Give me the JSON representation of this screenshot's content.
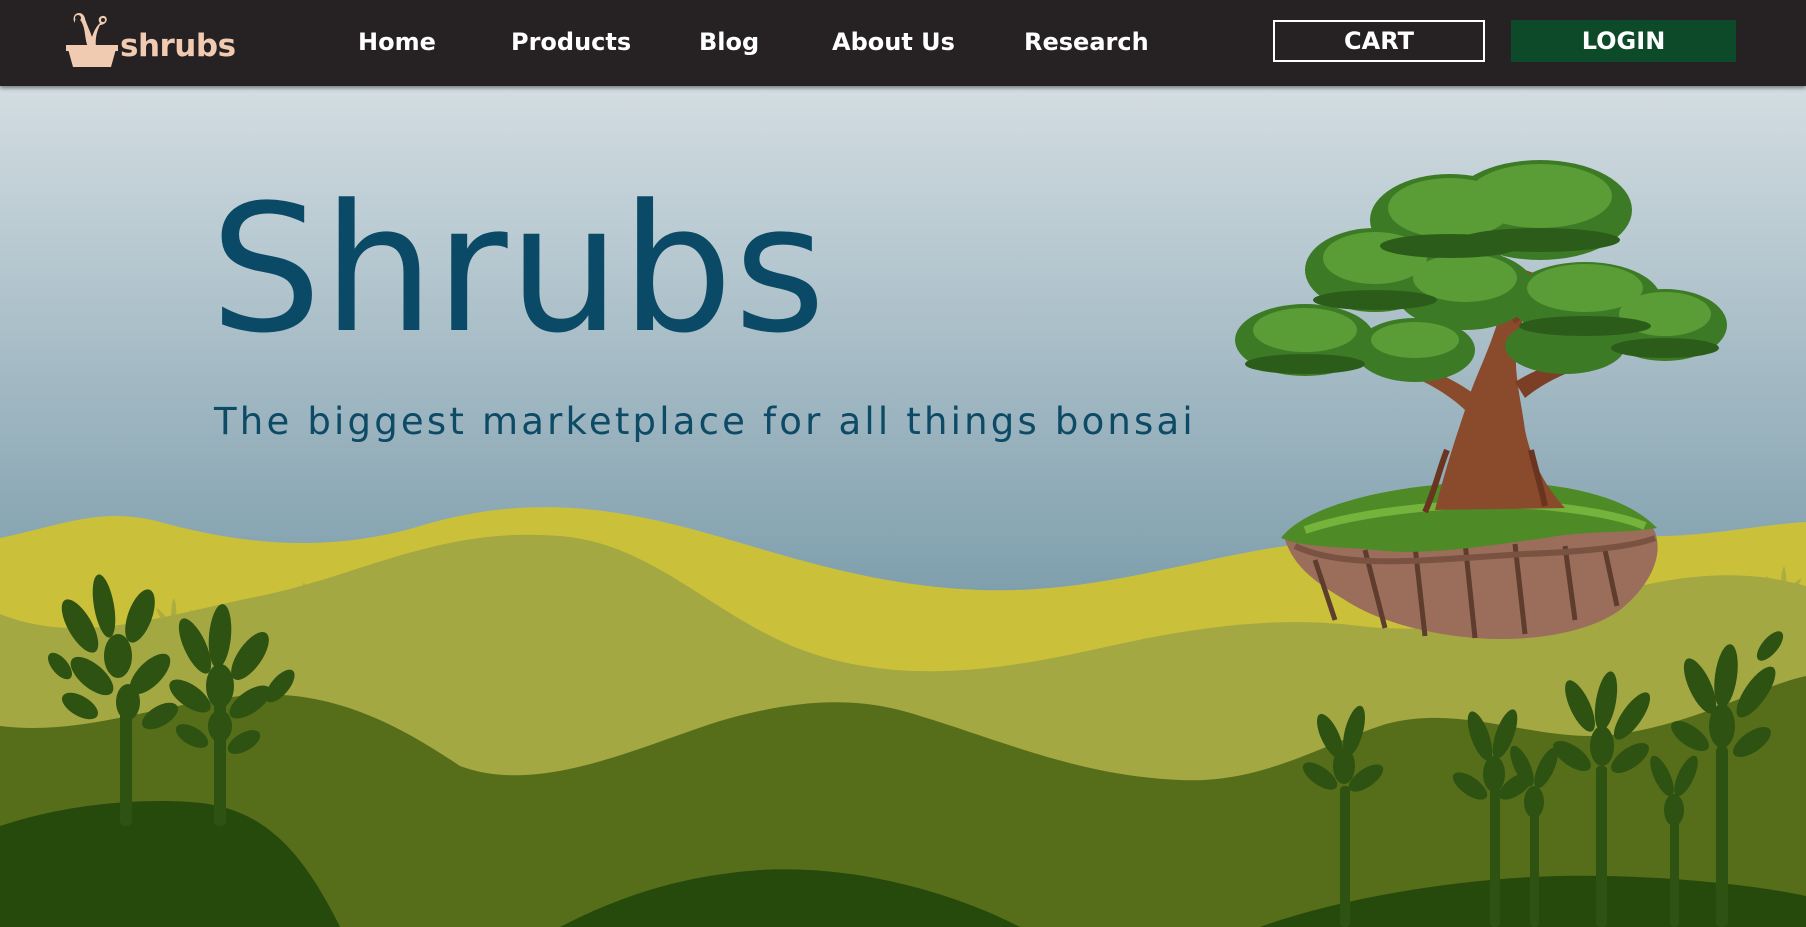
{
  "brand": {
    "name": "shrubs",
    "logo_icon": "bonsai-pot-icon",
    "color": "#f0cbb2"
  },
  "nav": {
    "links": [
      {
        "label": "Home"
      },
      {
        "label": "Products"
      },
      {
        "label": "Blog"
      },
      {
        "label": "About Us"
      },
      {
        "label": "Research"
      }
    ],
    "cart_label": "CART",
    "login_label": "LOGIN"
  },
  "hero": {
    "title": "Shrubs",
    "subtitle": "The biggest marketplace for all things bonsai",
    "image": "floating-island-bonsai-tree"
  },
  "colors": {
    "navbar": "#262223",
    "login_button": "#0d4a2a",
    "title": "#0b4a66",
    "sky_top": "#d3dde2",
    "sky_bottom": "#5f8799",
    "hill_light": "#cbc03a",
    "hill_mid": "#a3a843",
    "hill_dark": "#566e1a",
    "hill_darkest": "#264a0c",
    "plant": "#2e5212"
  }
}
